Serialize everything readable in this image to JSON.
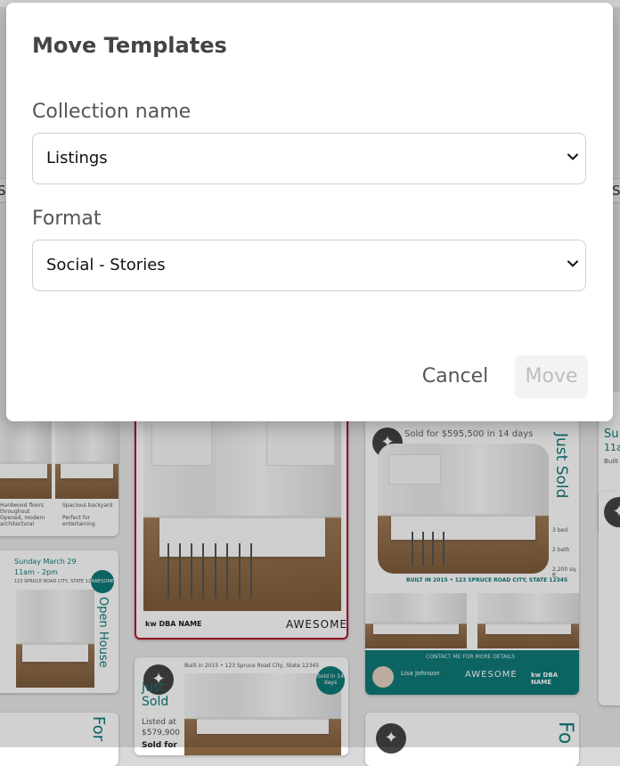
{
  "modal": {
    "title": "Move Templates",
    "collection": {
      "label": "Collection name",
      "value": "Listings"
    },
    "format": {
      "label": "Format",
      "value": "Social - Stories"
    },
    "cancel_label": "Cancel",
    "move_label": "Move"
  },
  "background": {
    "edge_labels": {
      "left": "S",
      "right": "S"
    },
    "cards": {
      "card_left_open_house": {
        "date": "Sunday March 29",
        "time": "11am - 2pm",
        "address": "123 SPRUCE ROAD CITY, STATE 12345",
        "vertical": "Open House",
        "badge": "AWESOME"
      },
      "card_center_selected": {
        "brand": "kw DBA NAME",
        "awesome": "AWESOME"
      },
      "card_right_just_sold": {
        "price_line": "Sold for  $595,500  in 14 days",
        "vertical": "Just Sold",
        "stats": [
          "3 bed",
          "2 bath",
          "2,200 sq. ft."
        ],
        "built": "BUILT IN 2015 • 123 SPRUCE ROAD CITY, STATE 12345",
        "contact": "CONTACT ME FOR MORE DETAILS",
        "agent_name": "Lisa Johnson",
        "awesome": "AWESOME",
        "brand": "kw DBA NAME"
      },
      "card_center_bottom": {
        "built": "Built in 2015 • 123 Spruce Road City, State 12345",
        "just": "Just",
        "sold": "Sold",
        "listed_at": "Listed at",
        "listed_price": "$579,900",
        "sold_for": "Sold for",
        "badge": "Sold in 14 days"
      },
      "card_right_edge": {
        "line1": "Su",
        "line2": "11a",
        "line3": "Built"
      },
      "card_left_bottom": {
        "vertical": "For"
      },
      "card_right_bottom": {
        "vertical": "Fo"
      },
      "card_left_top_bullets": [
        "Hardwood floors throughout",
        "Opened, modern architectural",
        "Spacious backyard",
        "Perfect for entertaining"
      ]
    }
  },
  "colors": {
    "accent_teal": "#0f7a78",
    "selected_border": "#b3122a",
    "text_dark": "#444444"
  }
}
